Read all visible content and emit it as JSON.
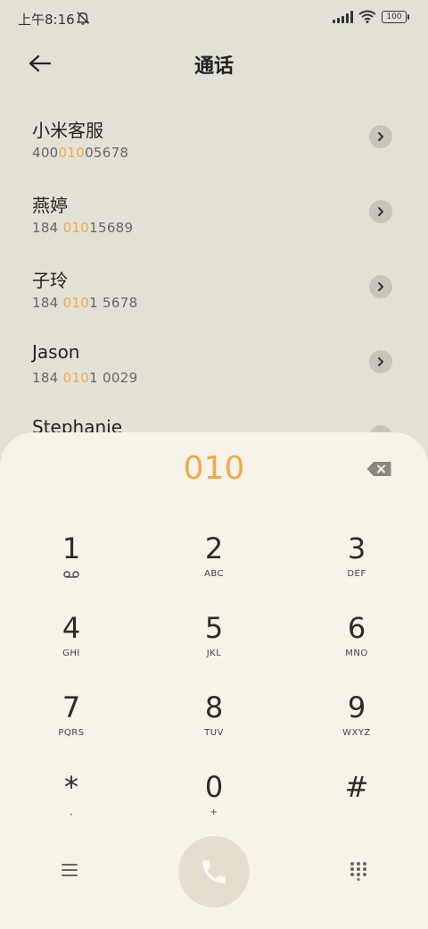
{
  "status_bar": {
    "time": "上午8:16",
    "battery": "100"
  },
  "header": {
    "title": "通话"
  },
  "contacts": [
    {
      "name": "小米客服",
      "number_pre": "400",
      "number_hl": "010",
      "number_post": "05678"
    },
    {
      "name": "燕婷",
      "number_pre": "184 ",
      "number_hl": "010",
      "number_post": "15689"
    },
    {
      "name": "子玲",
      "number_pre": "184 ",
      "number_hl": "010",
      "number_post": "1 5678"
    },
    {
      "name": "Jason",
      "number_pre": "184 ",
      "number_hl": "010",
      "number_post": "1 0029"
    },
    {
      "name": "Stephanie",
      "number_pre": "",
      "number_hl": "",
      "number_post": ""
    }
  ],
  "dialpad": {
    "dialed_number": "010",
    "keys": [
      [
        {
          "digit": "1",
          "letters": ""
        },
        {
          "digit": "2",
          "letters": "ABC"
        },
        {
          "digit": "3",
          "letters": "DEF"
        }
      ],
      [
        {
          "digit": "4",
          "letters": "GHI"
        },
        {
          "digit": "5",
          "letters": "JKL"
        },
        {
          "digit": "6",
          "letters": "MNO"
        }
      ],
      [
        {
          "digit": "7",
          "letters": "PQRS"
        },
        {
          "digit": "8",
          "letters": "TUV"
        },
        {
          "digit": "9",
          "letters": "WXYZ"
        }
      ],
      [
        {
          "digit": "*",
          "letters": ","
        },
        {
          "digit": "0",
          "letters": "+"
        },
        {
          "digit": "#",
          "letters": ""
        }
      ]
    ]
  },
  "colors": {
    "accent": "#f0a94a",
    "background": "#e3e1d6",
    "sheet": "#f7f3e8"
  },
  "icons": {
    "back": "arrow-left-icon",
    "bell": "bell-muted-icon",
    "detail": "chevron-right-icon",
    "backspace": "backspace-icon",
    "voicemail": "voicemail-icon",
    "menu": "menu-icon",
    "call": "phone-icon",
    "dialpad": "dialpad-grid-icon"
  }
}
